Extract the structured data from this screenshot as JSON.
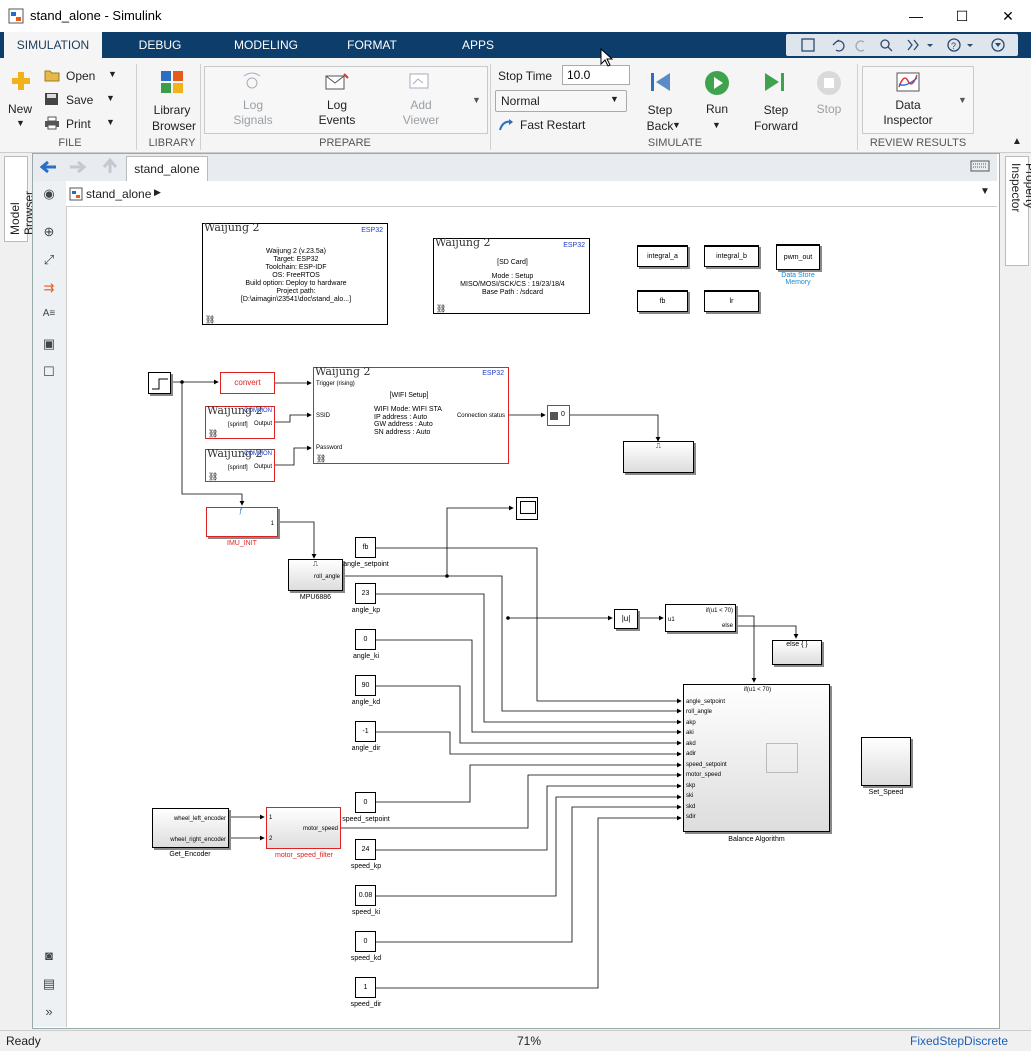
{
  "window": {
    "title": "stand_alone - Simulink",
    "minimize": "—",
    "maximize": "☐",
    "close": "✕"
  },
  "tabs": [
    {
      "label": "SIMULATION",
      "active": true
    },
    {
      "label": "DEBUG"
    },
    {
      "label": "MODELING"
    },
    {
      "label": "FORMAT"
    },
    {
      "label": "APPS"
    }
  ],
  "ribbon": {
    "file": {
      "new": "New",
      "open": "Open",
      "save": "Save",
      "print": "Print",
      "group": "FILE"
    },
    "library": {
      "browser_line1": "Library",
      "browser_line2": "Browser",
      "group": "LIBRARY"
    },
    "prepare": {
      "log_signals_1": "Log",
      "log_signals_2": "Signals",
      "log_events_1": "Log",
      "log_events_2": "Events",
      "add_viewer_1": "Add",
      "add_viewer_2": "Viewer",
      "group": "PREPARE"
    },
    "simulate": {
      "stop_time_label": "Stop Time",
      "stop_time_value": "10.0",
      "mode": "Normal",
      "fast_restart": "Fast Restart",
      "step_back_1": "Step",
      "step_back_2": "Back",
      "run": "Run",
      "step_forward_1": "Step",
      "step_forward_2": "Forward",
      "stop": "Stop",
      "group": "SIMULATE"
    },
    "review": {
      "inspector_1": "Data",
      "inspector_2": "Inspector",
      "group": "REVIEW RESULTS"
    }
  },
  "side": {
    "model_browser": "Model Browser",
    "property_inspector": "Property Inspector"
  },
  "editor": {
    "tab": "stand_alone",
    "breadcrumb": "stand_alone"
  },
  "status": {
    "left": "Ready",
    "zoom": "71%",
    "solver": "FixedStepDiscrete"
  },
  "colors": {
    "accent": "#0c3d6b",
    "block_red": "#dd2222",
    "link_blue": "#1a8ad6"
  },
  "diagram": {
    "waijung": "Waijung 2",
    "esp32": "ESP32",
    "common": "COMMON",
    "target_lines": [
      "Waijung 2 (v.23.5a)",
      "Target: ESP32",
      "Toolchain: ESP-IDF",
      "OS: FreeRTOS",
      "Build option: Deploy to hardware",
      "Project path:",
      "[D:\\aimagin\\23541\\doc\\stand_alo...]"
    ],
    "sd_lines": [
      "[SD Card]",
      "",
      "Mode : Setup",
      "MISO/MOSI/SCK/CS : 19/23/18/4",
      "Base Path : /sdcard"
    ],
    "wifi_lines": [
      "[WIFI Setup]",
      "",
      "WIFI Mode: WIFI STA",
      "IP address    : Auto",
      "GW address  : Auto",
      "SN address   : Auto"
    ],
    "wifi_ports": {
      "trigger": "Trigger (rising)",
      "ssid": "SSID",
      "password": "Password",
      "status": "Connection status"
    },
    "sprintf": "[sprintf]",
    "output": "Output",
    "stores": [
      "integral_a",
      "integral_b",
      "pwm_out",
      "fb",
      "lr"
    ],
    "data_store_memory": "Data Store\nMemory",
    "convert": "convert",
    "zero": "0",
    "imu_init": "IMU_INIT",
    "imu_port": "1",
    "mpu": "MPU6886",
    "roll_angle": "roll_angle",
    "abs_sym": "|u|",
    "u1": "u1",
    "if_cond": "if(u1 < 70)",
    "else": "else",
    "else_block": "else { }",
    "balance_title": "if(u1 < 70)",
    "balance_ports": [
      "angle_setpoint",
      "roll_angle",
      "akp",
      "aki",
      "akd",
      "adir",
      "speed_setpoint",
      "motor_speed",
      "skp",
      "ski",
      "skd",
      "sdir"
    ],
    "balance": "Balance Algorithm",
    "set_speed": "Set_Speed",
    "encoder_ports": [
      "wheel_left_encoder",
      "wheel_right_encoder"
    ],
    "get_encoder": "Get_Encoder",
    "filter": "motor_speed_filter",
    "filter_out": "motor_speed",
    "filter_in": [
      "1",
      "2"
    ],
    "constants": [
      {
        "value": "fb",
        "label": "angle_setpoint"
      },
      {
        "value": "23",
        "label": "angle_kp"
      },
      {
        "value": "0",
        "label": "angle_ki"
      },
      {
        "value": "90",
        "label": "angle_kd"
      },
      {
        "value": "-1",
        "label": "angle_dir"
      },
      {
        "value": "0",
        "label": "speed_setpoint"
      },
      {
        "value": "24",
        "label": "speed_kp"
      },
      {
        "value": "0.08",
        "label": "speed_ki"
      },
      {
        "value": "0",
        "label": "speed_kd"
      },
      {
        "value": "1",
        "label": "speed_dir"
      }
    ]
  }
}
